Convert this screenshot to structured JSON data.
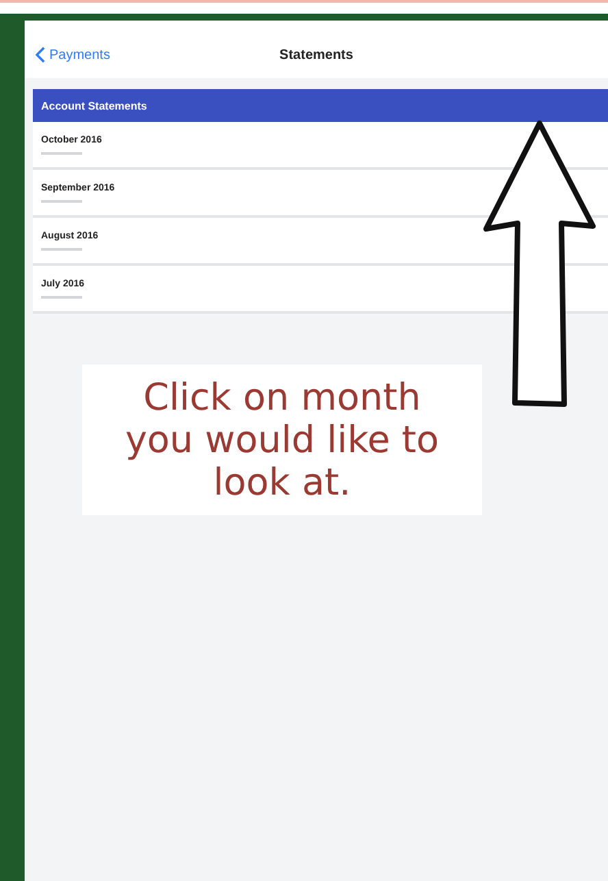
{
  "nav_bar": {
    "back_label": "Payments",
    "title": "Statements"
  },
  "section_header": "Account Statements",
  "statements": [
    {
      "month": "October 2016"
    },
    {
      "month": "September 2016"
    },
    {
      "month": "August 2016"
    },
    {
      "month": "July 2016"
    }
  ],
  "annotation": {
    "text": "Click on month you would like to look at."
  }
}
